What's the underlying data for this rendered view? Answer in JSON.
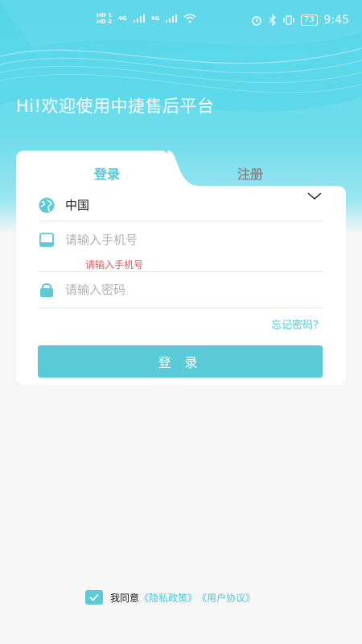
{
  "status_bar": {
    "hd1": "HD 1",
    "hd2": "HD 2",
    "net1": "4G",
    "net2": "4G",
    "battery": "73",
    "time": "9:45",
    "icons": [
      "signal-icon",
      "wifi-icon",
      "alarm-icon",
      "bluetooth-icon",
      "vibrate-icon",
      "battery-icon"
    ]
  },
  "hero": {
    "title": "Hi!欢迎使用中捷售后平台"
  },
  "tabs": {
    "login": "登录",
    "register": "注册"
  },
  "form": {
    "country": "中国",
    "phone_placeholder": "请输入手机号",
    "phone_error": "请输入手机号",
    "password_placeholder": "请输入密码",
    "forgot": "忘记密码？",
    "submit": "登 录"
  },
  "agreement": {
    "prefix": "我同意",
    "privacy": "《隐私政策》",
    "terms": "《用户协议》",
    "checked": true
  },
  "colors": {
    "accent": "#5ccbd8",
    "error": "#e45a5a",
    "hero": "#57d6e8"
  }
}
